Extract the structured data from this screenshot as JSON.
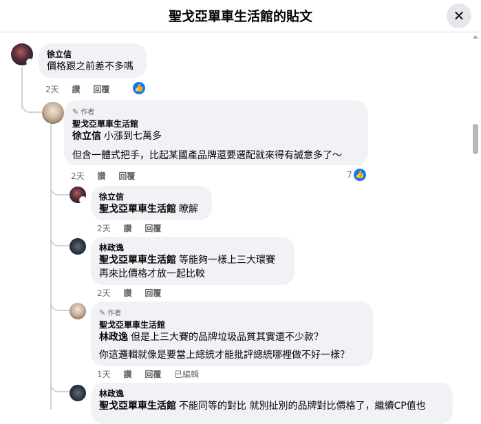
{
  "header": {
    "title": "聖戈亞單車生活館的貼文",
    "close_label": "✕"
  },
  "comments": [
    {
      "name": "徐立信",
      "text": "價格跟之前差不多嗎",
      "time": "2天",
      "like": "讚",
      "reply": "回覆"
    },
    {
      "author_tag": "作者",
      "name": "聖戈亞單車生活館",
      "mention": "徐立信",
      "line1": "小漲到七萬多",
      "line2": "但含一體式把手，比起某國產品牌還要選配就來得有誠意多了～",
      "time": "2天",
      "like": "讚",
      "reply": "回覆",
      "like_count": "7"
    },
    {
      "name": "徐立信",
      "mention": "聖戈亞單車生活館",
      "text": "瞭解",
      "time": "2天",
      "like": "讚",
      "reply": "回覆"
    },
    {
      "name": "林政逸",
      "mention": "聖戈亞單車生活館",
      "line1": "等能夠一樣上三大環賽",
      "line2": "再來比價格才放一起比較",
      "time": "2天",
      "like": "讚",
      "reply": "回覆"
    },
    {
      "author_tag": "作者",
      "name": "聖戈亞單車生活館",
      "mention": "林政逸",
      "line1": "但是上三大賽的品牌垃圾品質其實還不少款？",
      "line2": "你這邏輯就像是要當上總統才能批評總統哪裡做不好一樣？",
      "time": "1天",
      "like": "讚",
      "reply": "回覆",
      "edited": "已編輯"
    },
    {
      "name": "林政逸",
      "mention": "聖戈亞單車生活館",
      "text": "不能同等的對比 就別扯別的品牌對比價格了，繼續CP值也"
    }
  ]
}
